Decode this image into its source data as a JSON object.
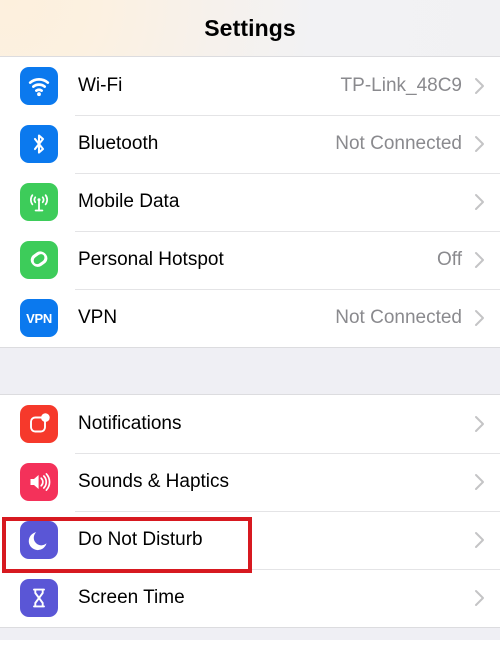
{
  "header": {
    "title": "Settings"
  },
  "colors": {
    "wifi_icon": "#0B79EE",
    "bluetooth_icon": "#0B79EE",
    "mobile_data_icon": "#3DCC5A",
    "hotspot_icon": "#3DCC5A",
    "vpn_icon": "#0B79EE",
    "notifications_icon": "#F6392B",
    "sounds_icon": "#F4315A",
    "dnd_icon": "#5A56D6",
    "screen_time_icon": "#5A56D6",
    "highlight": "#D71920",
    "value_text": "#8A8A8E",
    "group_background": "#EFEFF4"
  },
  "groups": [
    {
      "name": "connectivity",
      "rows": [
        {
          "label": "Wi-Fi",
          "value": "TP-Link_48C9",
          "icon": "wifi-icon",
          "chevron": "chevron-right-icon"
        },
        {
          "label": "Bluetooth",
          "value": "Not Connected",
          "icon": "bluetooth-icon",
          "chevron": "chevron-right-icon"
        },
        {
          "label": "Mobile Data",
          "value": "",
          "icon": "mobile-data-icon",
          "chevron": "chevron-right-icon"
        },
        {
          "label": "Personal Hotspot",
          "value": "Off",
          "icon": "personal-hotspot-icon",
          "chevron": "chevron-right-icon"
        },
        {
          "label": "VPN",
          "value": "Not Connected",
          "icon": "vpn-icon",
          "icon_text": "VPN",
          "chevron": "chevron-right-icon"
        }
      ]
    },
    {
      "name": "notifications-and-focus",
      "rows": [
        {
          "label": "Notifications",
          "value": "",
          "icon": "notifications-icon",
          "chevron": "chevron-right-icon"
        },
        {
          "label": "Sounds & Haptics",
          "value": "",
          "icon": "sounds-haptics-icon",
          "chevron": "chevron-right-icon"
        },
        {
          "label": "Do Not Disturb",
          "value": "",
          "icon": "do-not-disturb-icon",
          "chevron": "chevron-right-icon",
          "highlighted": true
        },
        {
          "label": "Screen Time",
          "value": "",
          "icon": "screen-time-icon",
          "chevron": "chevron-right-icon"
        }
      ]
    }
  ]
}
